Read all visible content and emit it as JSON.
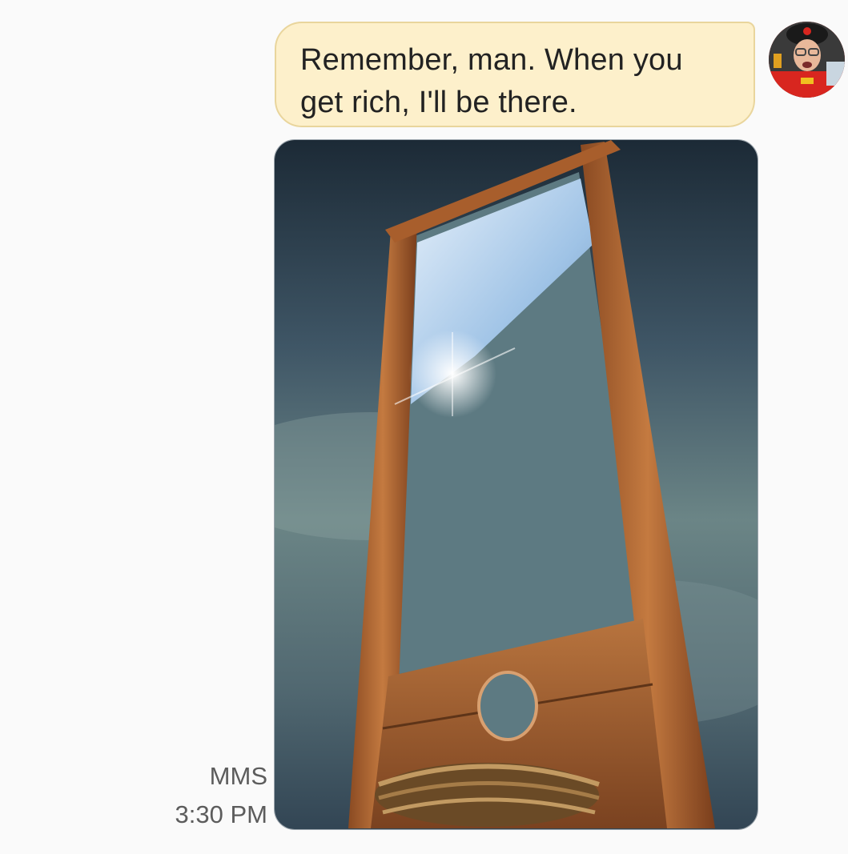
{
  "message": {
    "text": "Remember, man. When you get rich, I'll be there.",
    "type_label": "MMS",
    "time": "3:30 PM"
  },
  "attachment": {
    "kind": "image",
    "subject": "guillotine-photo"
  },
  "sender": {
    "avatar": "contact-avatar-photo"
  },
  "colors": {
    "bubble_bg": "#fdf0cb",
    "bubble_border": "#e9d59c",
    "meta_text": "#5c5c5c",
    "page_bg": "#fafafa"
  }
}
